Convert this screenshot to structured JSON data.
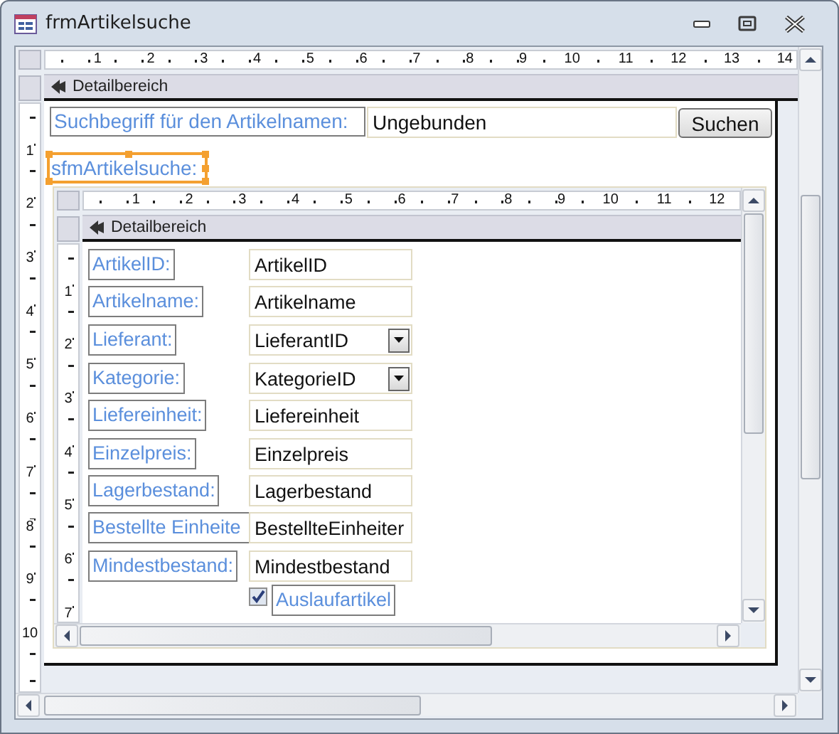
{
  "window": {
    "title": "frmArtikelsuche"
  },
  "ruler": {
    "horizontal": [
      "1",
      "2",
      "3",
      "4",
      "5",
      "6",
      "7",
      "8",
      "9",
      "10",
      "11",
      "12",
      "13",
      "14"
    ],
    "vertical": [
      "1",
      "2",
      "3",
      "4",
      "5",
      "6",
      "7",
      "8",
      "9",
      "10"
    ]
  },
  "form": {
    "section": "Detailbereich",
    "search_label": "Suchbegriff für den Artikelnamen:",
    "search_field": {
      "value": "Ungebunden"
    },
    "button": "Suchen",
    "subform_label": {
      "text": "sfmArtikelsuche:",
      "selected": true
    }
  },
  "subform": {
    "ruler": {
      "horizontal": [
        "1",
        "2",
        "3",
        "4",
        "5",
        "6",
        "7",
        "8",
        "9",
        "10",
        "11",
        "12"
      ],
      "vertical": [
        "1",
        "2",
        "3",
        "4",
        "5",
        "6",
        "7"
      ]
    },
    "section": "Detailbereich",
    "rows": [
      {
        "kind": "textbox",
        "label": "ArtikelID:",
        "field": "ArtikelID"
      },
      {
        "kind": "textbox",
        "label": "Artikelname:",
        "field": "Artikelname"
      },
      {
        "kind": "combobox",
        "label": "Lieferant:",
        "field": "LieferantID"
      },
      {
        "kind": "combobox",
        "label": "Kategorie:",
        "field": "KategorieID"
      },
      {
        "kind": "textbox",
        "label": "Liefereinheit:",
        "field": "Liefereinheit"
      },
      {
        "kind": "textbox",
        "label": "Einzelpreis:",
        "field": "Einzelpreis"
      },
      {
        "kind": "textbox",
        "label": "Lagerbestand:",
        "field": "Lagerbestand"
      },
      {
        "kind": "textbox",
        "label": "Bestellte Einheite",
        "field": "BestellteEinheiter"
      },
      {
        "kind": "textbox",
        "label": "Mindestbestand:",
        "field": "Mindestbestand"
      },
      {
        "kind": "checkbox",
        "label": "Auslaufartikel",
        "checked": true
      }
    ]
  }
}
